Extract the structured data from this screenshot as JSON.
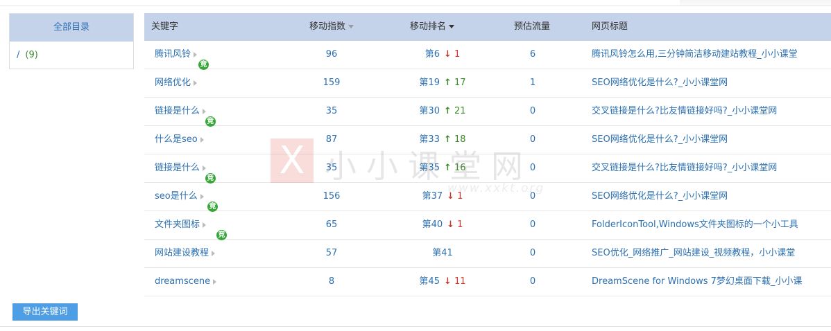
{
  "sidebar": {
    "title": "全部目录",
    "item": {
      "slash": "/",
      "count": "(9)"
    }
  },
  "table": {
    "headers": {
      "keyword": "关键字",
      "mobile_index": "移动指数",
      "mobile_rank": "移动排名",
      "estimated_traffic": "预估流量",
      "page_title": "网页标题"
    },
    "rows": [
      {
        "keyword": "腾讯风铃",
        "jing": false,
        "index": "96",
        "rank": "第6",
        "dir": "down",
        "change": "1",
        "traffic": "6",
        "title": "腾讯风铃怎么用,三分钟简洁移动建站教程_小小课堂"
      },
      {
        "keyword": "网络优化",
        "jing": true,
        "index": "159",
        "rank": "第19",
        "dir": "up",
        "change": "17",
        "traffic": "1",
        "title": "SEO网络优化是什么?_小小课堂网"
      },
      {
        "keyword": "链接是什么",
        "jing": false,
        "index": "35",
        "rank": "第30",
        "dir": "up",
        "change": "21",
        "traffic": "0",
        "title": "交叉链接是什么?比友情链接好吗?_小小课堂网"
      },
      {
        "keyword": "什么是seo",
        "jing": true,
        "index": "87",
        "rank": "第33",
        "dir": "up",
        "change": "18",
        "traffic": "0",
        "title": "SEO网络优化是什么?_小小课堂网"
      },
      {
        "keyword": "链接是什么",
        "jing": false,
        "index": "35",
        "rank": "第35",
        "dir": "up",
        "change": "16",
        "traffic": "0",
        "title": "交叉链接是什么?比友情链接好吗?_小小课堂网"
      },
      {
        "keyword": "seo是什么",
        "jing": true,
        "index": "156",
        "rank": "第37",
        "dir": "down",
        "change": "1",
        "traffic": "0",
        "title": "SEO网络优化是什么?_小小课堂网"
      },
      {
        "keyword": "文件夹图标",
        "jing": true,
        "index": "65",
        "rank": "第40",
        "dir": "down",
        "change": "1",
        "traffic": "0",
        "title": "FolderIconTool,Windows文件夹图标的一个小工具"
      },
      {
        "keyword": "网站建设教程",
        "jing": true,
        "index": "57",
        "rank": "第41",
        "dir": "",
        "change": "",
        "traffic": "0",
        "title": "SEO优化_网络推广_网站建设_视频教程，小小课堂"
      },
      {
        "keyword": "dreamscene",
        "jing": false,
        "index": "8",
        "rank": "第45",
        "dir": "down",
        "change": "11",
        "traffic": "0",
        "title": "DreamScene for Windows 7梦幻桌面下载_小小课"
      }
    ]
  },
  "jing_label": "竞",
  "arrows": {
    "up": "↑",
    "down": "↓"
  },
  "export_button": "导出关键词",
  "watermark": {
    "logo_char": "X",
    "text": "小小课堂网",
    "url": "www.xxkt.org"
  },
  "colors": {
    "accent_blue": "#2b6fb0",
    "header_bg": "#c5d3ea",
    "up_green": "#3b8a2a",
    "down_red": "#d9342b",
    "button_blue": "#4d9ee4",
    "jing_green": "#35a837"
  }
}
